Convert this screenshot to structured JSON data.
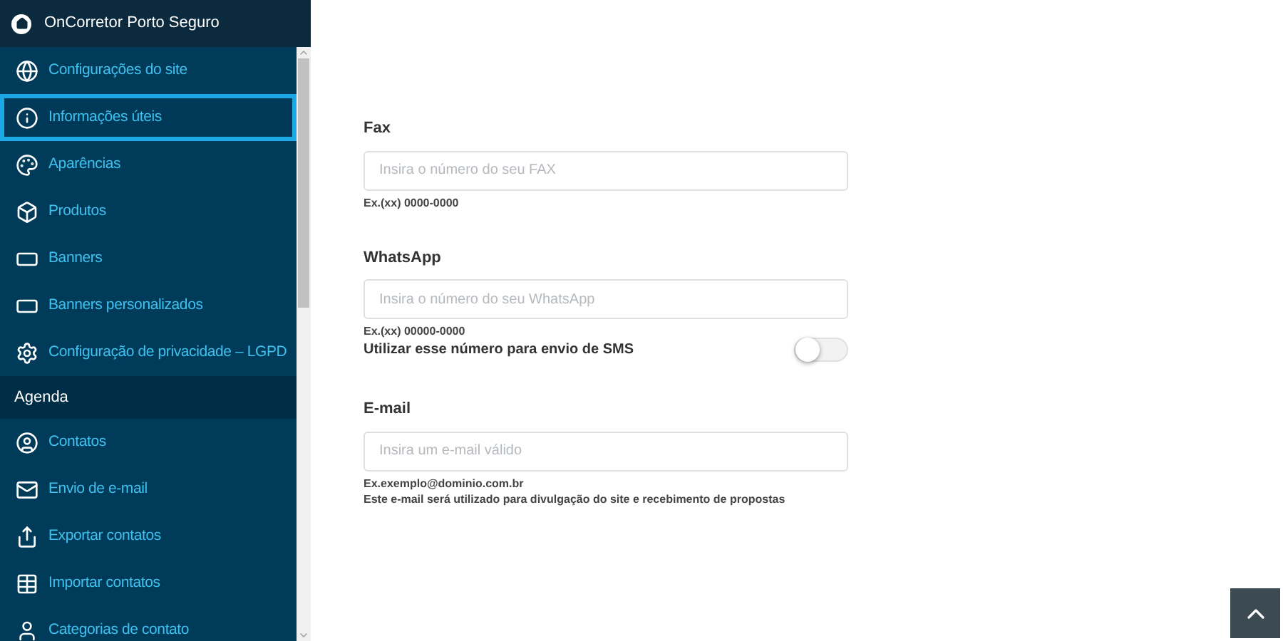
{
  "header": {
    "title": "OnCorretor Porto Seguro"
  },
  "sidebar": {
    "items": [
      {
        "kind": "link",
        "label": "Configurações do site",
        "selected": false
      },
      {
        "kind": "link",
        "label": "Informações úteis",
        "selected": true
      },
      {
        "kind": "link",
        "label": "Aparências",
        "selected": false
      },
      {
        "kind": "link",
        "label": "Produtos",
        "selected": false
      },
      {
        "kind": "link",
        "label": "Banners",
        "selected": false
      },
      {
        "kind": "link",
        "label": "Banners personalizados",
        "selected": false
      },
      {
        "kind": "link",
        "label": "Configuração de privacidade – LGPD",
        "selected": false
      },
      {
        "kind": "section",
        "label": "Agenda"
      },
      {
        "kind": "link",
        "label": "Contatos",
        "selected": false
      },
      {
        "kind": "link",
        "label": "Envio de e-mail",
        "selected": false
      },
      {
        "kind": "link",
        "label": "Exportar contatos",
        "selected": false
      },
      {
        "kind": "link",
        "label": "Importar contatos",
        "selected": false
      },
      {
        "kind": "link",
        "label": "Categorias de contato",
        "selected": false
      }
    ]
  },
  "form": {
    "fields": [
      {
        "label": "Fax",
        "placeholder": "Insira o número do seu FAX",
        "hints": [
          "Ex.(xx) 0000-0000"
        ]
      },
      {
        "label": "WhatsApp",
        "placeholder": "Insira o número do seu WhatsApp",
        "hints": [
          "Ex.(xx) 00000-0000"
        ],
        "toggle": {
          "label": "Utilizar esse número para envio de SMS",
          "on": false
        }
      },
      {
        "label": "E-mail",
        "placeholder": "Insira um e-mail válido",
        "hints": [
          "Ex.exemplo@dominio.com.br",
          "Este e-mail será utilizado para divulgação do site e recebimento de propostas"
        ]
      }
    ]
  }
}
